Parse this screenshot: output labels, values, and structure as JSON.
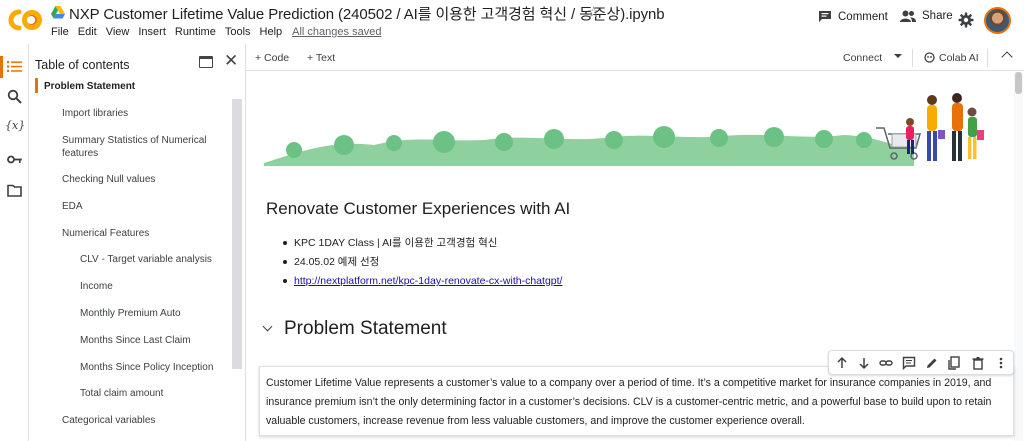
{
  "app": {
    "title": "NXP Customer Lifetime Value Prediction (240502 / AI를 이용한 고객경험 혁신 / 동준상).ipynb",
    "menu": [
      "File",
      "Edit",
      "View",
      "Insert",
      "Runtime",
      "Tools",
      "Help"
    ],
    "save_status": "All changes saved",
    "comment_label": "Comment",
    "share_label": "Share",
    "accent_color": "#e8710a",
    "link_color": "#1a0dab"
  },
  "rail": {
    "icons": [
      "toc-list-icon",
      "search-icon",
      "variables-icon",
      "key-icon",
      "folder-icon"
    ]
  },
  "toc": {
    "title": "Table of contents",
    "items": [
      {
        "label": "Problem Statement",
        "level": 1,
        "active": true
      },
      {
        "label": "Import libraries",
        "level": 2
      },
      {
        "label": "Summary Statistics of Numerical features",
        "level": 2
      },
      {
        "label": "Checking Null values",
        "level": 2
      },
      {
        "label": "EDA",
        "level": 2
      },
      {
        "label": "Numerical Features",
        "level": 2
      },
      {
        "label": "CLV - Target variable analysis",
        "level": 3
      },
      {
        "label": "Income",
        "level": 3
      },
      {
        "label": "Monthly Premium Auto",
        "level": 3
      },
      {
        "label": "Months Since Last Claim",
        "level": 3
      },
      {
        "label": "Months Since Policy Inception",
        "level": 3
      },
      {
        "label": "Total claim amount",
        "level": 3
      },
      {
        "label": "Categorical variables",
        "level": 2
      }
    ]
  },
  "toolbar": {
    "code_label": "+ Code",
    "text_label": "+ Text",
    "connect_label": "Connect",
    "colab_ai_label": "Colab AI"
  },
  "notebook": {
    "heading": "Renovate Customer Experiences with AI",
    "bullets": [
      "KPC 1DAY Class | AI를 이용한 고객경험 혁신",
      "24.05.02 예제 선정",
      "http://nextplatform.net/kpc-1day-renovate-cx-with-chatgpt/"
    ],
    "section_title": "Problem Statement",
    "cell_toolbar_icons": [
      "arrow-up-icon",
      "arrow-down-icon",
      "link-icon",
      "comment-icon",
      "edit-icon",
      "mirror-cell-icon",
      "delete-icon",
      "more-icon"
    ],
    "paragraph": "Customer Lifetime Value represents a customer’s value to a company over a period of time. It’s a competitive market for insurance companies in 2019, and insurance premium isn’t the only determining factor in a customer’s decisions. CLV is a customer-centric metric, and a powerful base to build upon to retain valuable customers, increase revenue from less valuable customers, and improve the customer experience overall."
  }
}
